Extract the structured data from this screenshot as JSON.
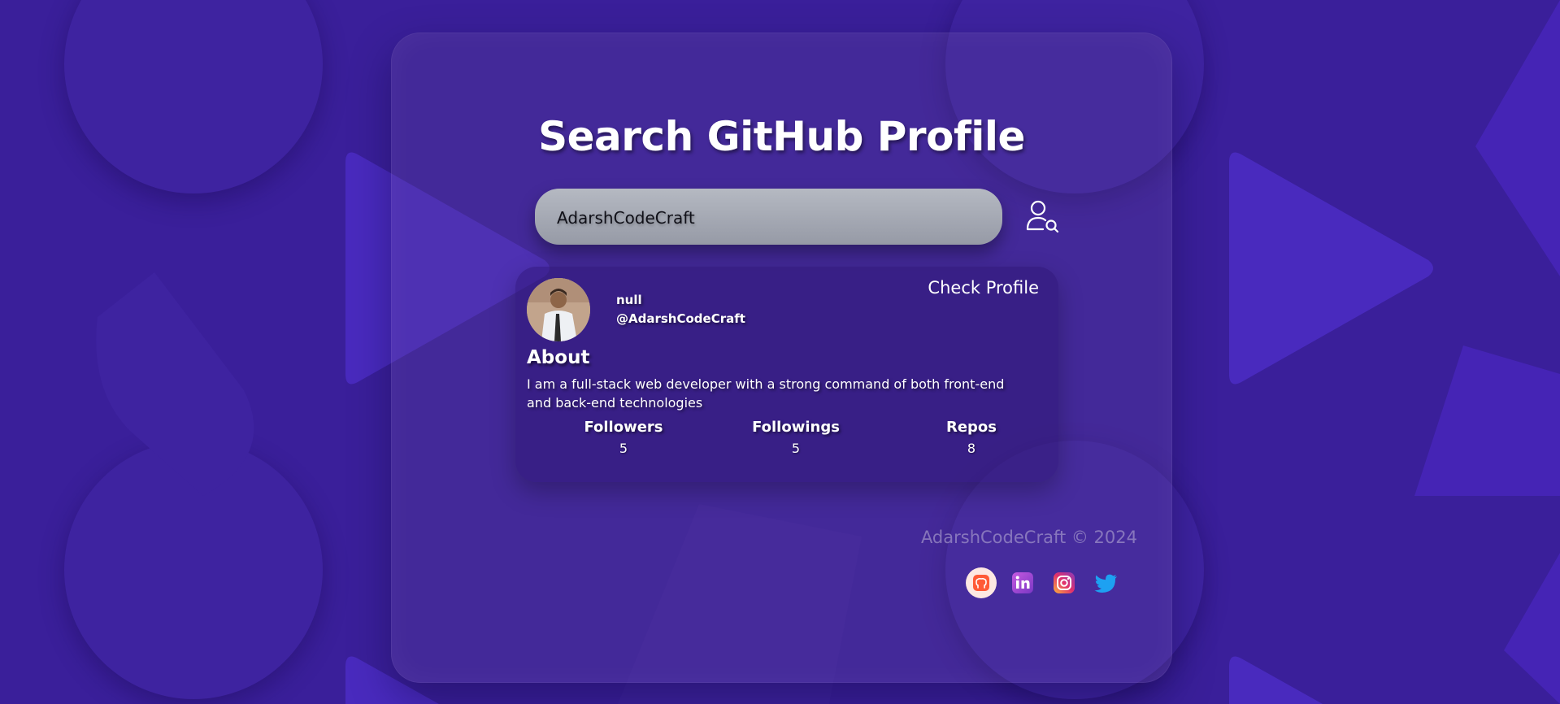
{
  "header": {
    "title": "Search GitHub Profile"
  },
  "search": {
    "value": "AdarshCodeCraft",
    "button_icon": "user-search-icon"
  },
  "profile": {
    "name": "null",
    "login": "@AdarshCodeCraft",
    "check_profile_label": "Check Profile",
    "about_title": "About",
    "about_text": "I am a full-stack web developer with a strong command of both front-end and back-end technologies",
    "stats": [
      {
        "label": "Followers",
        "value": "5"
      },
      {
        "label": "Followings",
        "value": "5"
      },
      {
        "label": "Repos",
        "value": "8"
      }
    ]
  },
  "footer": {
    "copyright": "AdarshCodeCraft © 2024",
    "socials": [
      {
        "icon": "github-icon",
        "color": "#ff5a36"
      },
      {
        "icon": "linkedin-icon",
        "color": "#a84fd6"
      },
      {
        "icon": "instagram-icon",
        "color": "#e1306c"
      },
      {
        "icon": "twitter-icon",
        "color": "#1da1f2"
      }
    ]
  },
  "colors": {
    "background": "#3a1f9a",
    "accent_shape": "#4a2bc0"
  }
}
